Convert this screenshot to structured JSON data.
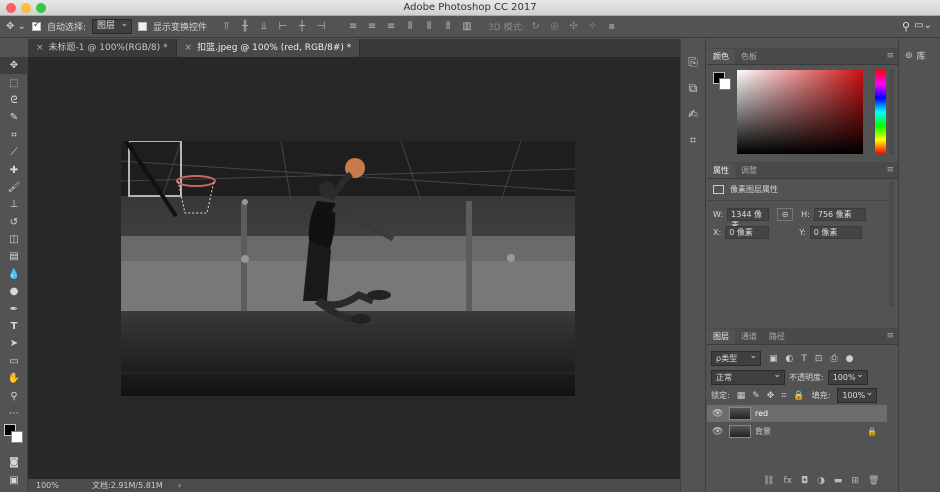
{
  "window": {
    "title": "Adobe Photoshop CC 2017"
  },
  "options": {
    "auto_select_label": "自动选择:",
    "auto_select_value": "图层",
    "show_transform_label": "显示变换控件",
    "mode_3d_label": "3D 模式:"
  },
  "tabs": [
    {
      "label": "未标题-1 @ 100%(RGB/8) *"
    },
    {
      "label": "扣篮.jpeg @ 100% (red, RGB/8#) *"
    }
  ],
  "status": {
    "zoom": "100%",
    "doc": "文档:2.91M/5.81M",
    "arrow": "›"
  },
  "color_panel": {
    "tabs": [
      "颜色",
      "色板"
    ],
    "hue_color": "#cc1111"
  },
  "properties_panel": {
    "tabs": [
      "属性",
      "调整"
    ],
    "header": "像素图层属性",
    "w_label": "W:",
    "w_value": "1344 像素",
    "h_label": "H:",
    "h_value": "756 像素",
    "x_label": "X:",
    "x_value": "0 像素",
    "y_label": "Y:",
    "y_value": "0 像素"
  },
  "layers_panel": {
    "tabs": [
      "图层",
      "通道",
      "路径"
    ],
    "filter_label": "ρ类型",
    "blend_mode": "正常",
    "opacity_label": "不透明度:",
    "opacity_value": "100%",
    "lock_label": "锁定:",
    "fill_label": "填充:",
    "fill_value": "100%",
    "layers": [
      {
        "name": "red"
      },
      {
        "name": "背景"
      }
    ]
  },
  "library": {
    "label": "库"
  }
}
